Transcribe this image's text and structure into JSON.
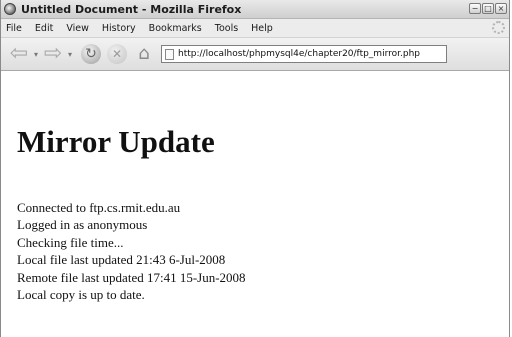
{
  "window": {
    "title": "Untitled Document - Mozilla Firefox",
    "controls": [
      "−",
      "□",
      "×"
    ]
  },
  "menu": {
    "items": [
      "File",
      "Edit",
      "View",
      "History",
      "Bookmarks",
      "Tools",
      "Help"
    ]
  },
  "navbar": {
    "url": "http://localhost/phpmysql4e/chapter20/ftp_mirror.php"
  },
  "page": {
    "heading": "Mirror Update",
    "lines": [
      "Connected to ftp.cs.rmit.edu.au",
      "Logged in as anonymous",
      "Checking file time...",
      "Local file last updated 21:43 6-Jul-2008",
      "Remote file last updated 17:41 15-Jun-2008",
      "Local copy is up to date."
    ]
  }
}
